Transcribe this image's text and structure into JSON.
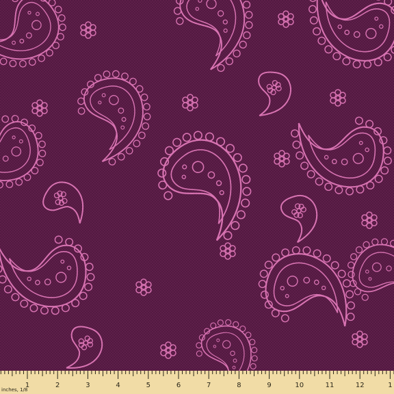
{
  "fabric": {
    "background_color": "#5e1f4a",
    "weave_color": "#4a163a",
    "motif_color": "#d873b2",
    "motifs": [
      "paisley",
      "flower"
    ]
  },
  "ruler": {
    "caption": "inches, 1/8",
    "color": "#f1dca6",
    "numbers": [
      "1",
      "2",
      "3",
      "4",
      "5",
      "6",
      "7",
      "8",
      "9",
      "10",
      "11",
      "12",
      "1"
    ]
  }
}
